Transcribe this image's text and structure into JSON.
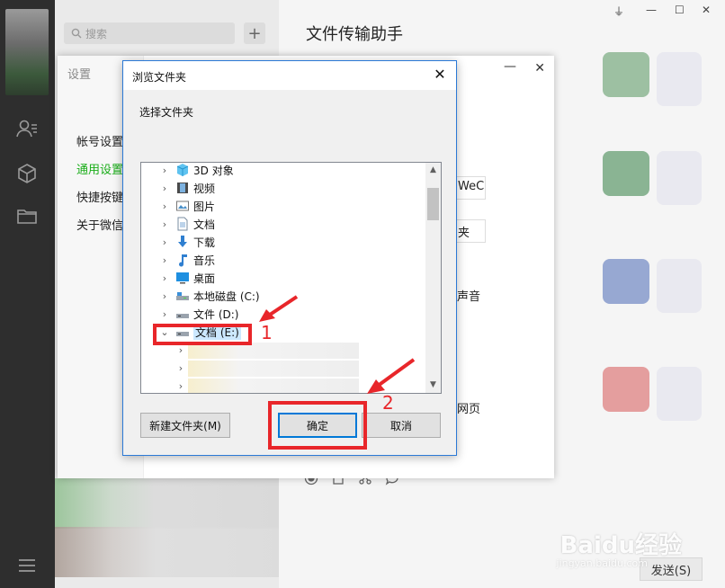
{
  "wechat": {
    "search_placeholder": "搜索",
    "add_button": "+",
    "chat_title": "文件传输助手",
    "window_controls": [
      "⏚",
      "—",
      "☐",
      "✕"
    ],
    "send_button": "发送(S)"
  },
  "settings": {
    "title": "设置",
    "nav": [
      "帐号设置",
      "通用设置",
      "快捷按键",
      "关于微信"
    ],
    "active_nav_index": 1,
    "min": "—",
    "close": "✕",
    "visible_fragments": [
      "WeC",
      "夹",
      "声音",
      "网页"
    ]
  },
  "dialog": {
    "title": "浏览文件夹",
    "close": "✕",
    "prompt": "选择文件夹",
    "tree": [
      {
        "label": "3D 对象",
        "icon": "3d-objects-icon",
        "expanded": false
      },
      {
        "label": "视频",
        "icon": "video-icon",
        "expanded": false
      },
      {
        "label": "图片",
        "icon": "pictures-icon",
        "expanded": false
      },
      {
        "label": "文档",
        "icon": "documents-icon",
        "expanded": false
      },
      {
        "label": "下载",
        "icon": "download-icon",
        "expanded": false
      },
      {
        "label": "音乐",
        "icon": "music-icon",
        "expanded": false
      },
      {
        "label": "桌面",
        "icon": "desktop-icon",
        "expanded": false
      },
      {
        "label": "本地磁盘 (C:)",
        "icon": "local-disk-icon",
        "expanded": false
      },
      {
        "label": "文件 (D:)",
        "icon": "drive-icon",
        "expanded": false
      },
      {
        "label": "文档 (E:)",
        "icon": "drive-icon",
        "expanded": true,
        "selected": true
      }
    ],
    "new_folder_button": "新建文件夹(M)",
    "ok_button": "确定",
    "cancel_button": "取消"
  },
  "annotations": {
    "step1": "1",
    "step2": "2",
    "color": "#e8262a"
  },
  "watermark": {
    "brand": "Baidu经验",
    "url": "jingyan.baidu.com"
  },
  "colors": {
    "accent_green": "#1aad19",
    "dialog_border": "#2b79d6",
    "selection": "#cce8ff"
  }
}
